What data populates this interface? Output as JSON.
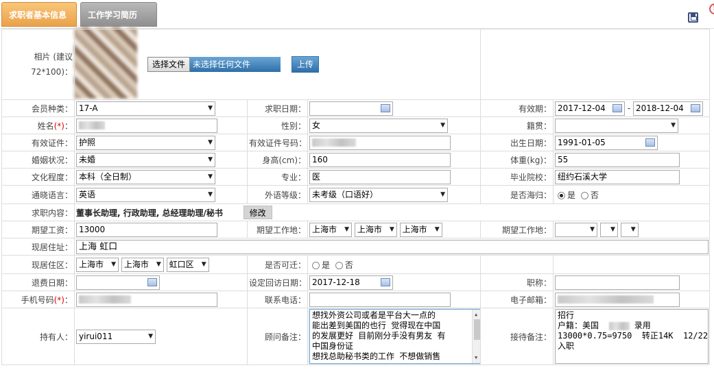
{
  "tabs": [
    {
      "label": "求职者基本信息",
      "active": true
    },
    {
      "label": "工作学习简历",
      "active": false
    }
  ],
  "icons": {
    "save": "save-icon",
    "alert": "alert-circle-icon"
  },
  "photo": {
    "label_line1": "相片 (建议",
    "label_line2": "72*100)：",
    "choose_file_label": "选择文件",
    "no_file_text": "未选择任何文件",
    "upload_label": "上传"
  },
  "form": {
    "member_type": {
      "label": "会员种类：",
      "value": "17-A"
    },
    "job_date": {
      "label": "求职日期：",
      "value": ""
    },
    "valid_period": {
      "label": "有效期：",
      "start": "2017-12-04",
      "sep": "-",
      "end": "2018-12-04"
    },
    "name": {
      "label": "姓名",
      "req": "(*)",
      "colon": "："
    },
    "gender": {
      "label": "性别：",
      "value": "女"
    },
    "native_place": {
      "label": "籍贯：",
      "value": ""
    },
    "id_type": {
      "label": "有效证件：",
      "value": "护照"
    },
    "id_number": {
      "label": "有效证件号码："
    },
    "birth_date": {
      "label": "出生日期：",
      "value": "1991-01-05"
    },
    "marital": {
      "label": "婚姻状况：",
      "value": "未婚"
    },
    "height": {
      "label": "身高(cm)：",
      "value": "160"
    },
    "weight": {
      "label": "体重(kg)：",
      "value": "55"
    },
    "education": {
      "label": "文化程度：",
      "value": "本科（全日制）"
    },
    "major": {
      "label": "专业：",
      "value": "医"
    },
    "school": {
      "label": "毕业院校：",
      "value": "纽约石溪大学"
    },
    "language": {
      "label": "通晓语言：",
      "value": "英语"
    },
    "foreign_level": {
      "label": "外语等级：",
      "value": "未考级（口语好）"
    },
    "returnee": {
      "label": "是否海归：",
      "yes": "是",
      "no": "否",
      "selected": "是"
    },
    "job_content": {
      "label": "求职内容：",
      "value": "董事长助理, 行政助理, 总经理助理/秘书",
      "edit_label": "修改"
    },
    "salary": {
      "label": "期望工资：",
      "value": "13000"
    },
    "work_place1": {
      "label": "期望工作地：",
      "values": [
        "上海市",
        "上海市",
        "上海市"
      ]
    },
    "work_place2": {
      "label": "期望工作地：",
      "values": [
        "",
        "",
        ""
      ]
    },
    "address": {
      "label": "现居住址：",
      "value": "上海 虹口"
    },
    "district": {
      "label": "现居住区：",
      "values": [
        "上海市",
        "上海市",
        "虹口区"
      ]
    },
    "relocate": {
      "label": "是否可迁：",
      "yes": "是",
      "no": "否",
      "selected": ""
    },
    "refund_date": {
      "label": "退费日期：",
      "value": ""
    },
    "revisit_date": {
      "label": "设定回访日期：",
      "value": "2017-12-18"
    },
    "title": {
      "label": "职称：",
      "value": ""
    },
    "mobile": {
      "label": "手机号码",
      "req": "(*)",
      "colon": "："
    },
    "phone": {
      "label": "联系电话：",
      "value": ""
    },
    "email": {
      "label": "电子邮箱："
    },
    "holder": {
      "label": "持有人：",
      "value": "yirui011"
    },
    "consultant_note": {
      "label": "顾问备注：",
      "value": "想找外资公司或者是平台大一点的\n能出差到美国的也行 觉得现在中国\n的发展更好 目前刚分手没有男友 有\n中国身份证\n想找总助秘书类的工作 不想做销售"
    },
    "reception_note": {
      "label": "接待备注：",
      "line1": "招行",
      "line2a": "户籍：美国",
      "line2b": "录用",
      "line3": "13000*0.75=9750  转正14K  12/22",
      "line4": "入职"
    }
  }
}
